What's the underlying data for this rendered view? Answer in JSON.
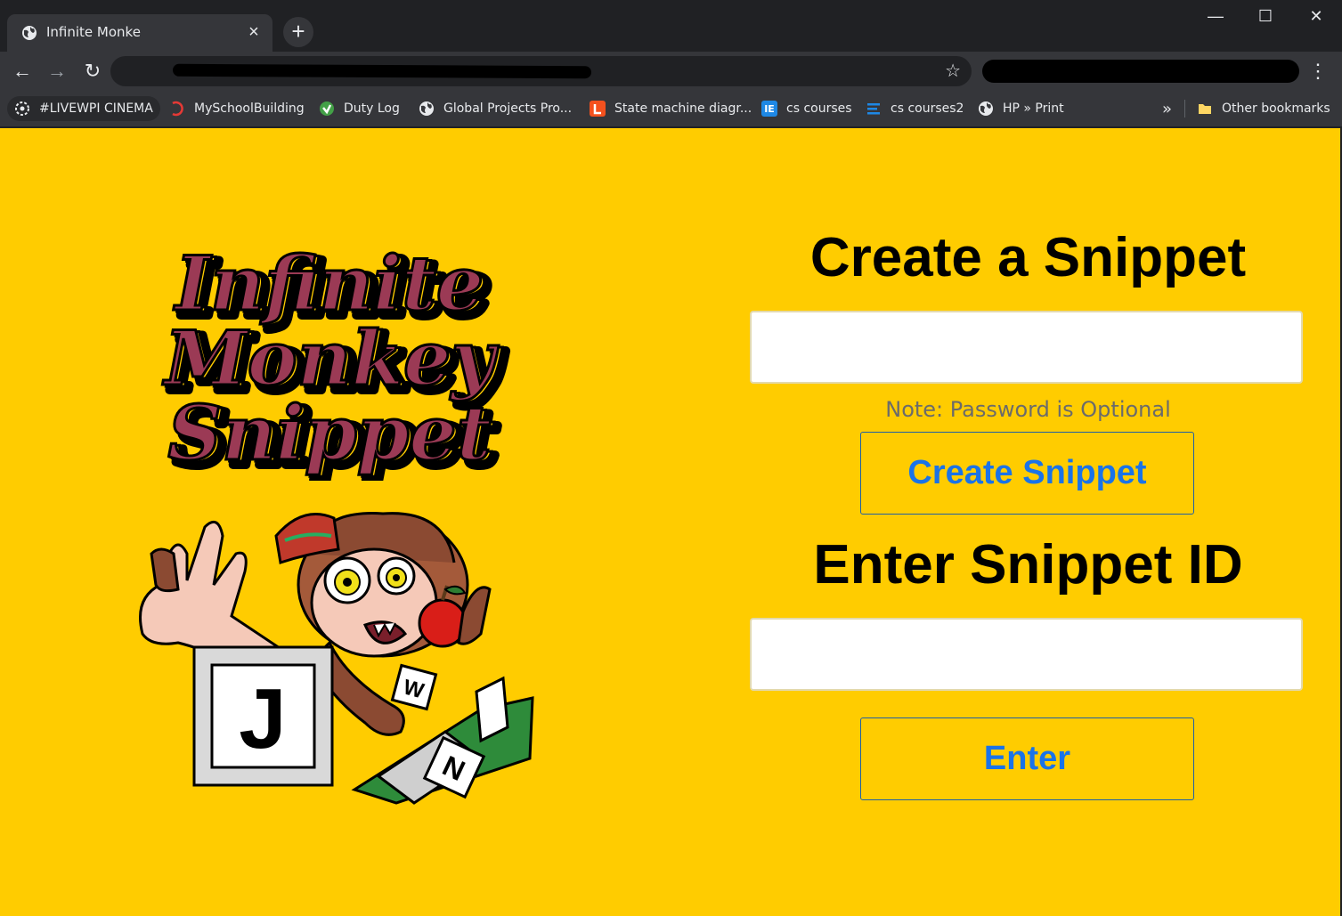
{
  "browser": {
    "tab_title": "Infinite Monke",
    "tab_close": "×",
    "new_tab": "+",
    "window_controls": {
      "minimize": "—",
      "maximize": "☐",
      "close": "✕"
    },
    "nav": {
      "back": "←",
      "forward": "→",
      "reload": "↻",
      "menu": "⋮",
      "star": "☆"
    },
    "bookmarks": [
      {
        "label": "#LIVEWPI CINEMA",
        "icon": "livewpi-icon",
        "color": "#ffffff"
      },
      {
        "label": "MySchoolBuilding",
        "icon": "myschoolbuilding-icon",
        "color": "#e53935"
      },
      {
        "label": "Duty Log",
        "icon": "duty-log-icon",
        "color": "#43a047"
      },
      {
        "label": "Global Projects Pro...",
        "icon": "globe-icon",
        "color": "#e8eaed"
      },
      {
        "label": "State machine diagr...",
        "icon": "state-machine-icon",
        "color": "#f4511e"
      },
      {
        "label": "cs courses",
        "icon": "ie-icon",
        "color": "#1e88e5"
      },
      {
        "label": "cs courses2",
        "icon": "list-icon",
        "color": "#1e88e5"
      },
      {
        "label": "HP » Print",
        "icon": "globe-icon",
        "color": "#e8eaed"
      }
    ],
    "overflow": "»",
    "other_bookmarks": "Other bookmarks"
  },
  "page": {
    "background": "#ffcc00",
    "logo_lines": [
      "Infinite",
      "Monkey",
      "Snippet"
    ],
    "create": {
      "heading": "Create a Snippet",
      "input_value": "",
      "note": "Note: Password is Optional",
      "button_label": "Create Snippet"
    },
    "enter": {
      "heading": "Enter Snippet ID",
      "input_value": "",
      "button_label": "Enter"
    },
    "key_labels": {
      "j": "J",
      "w": "W",
      "n": "N"
    }
  }
}
